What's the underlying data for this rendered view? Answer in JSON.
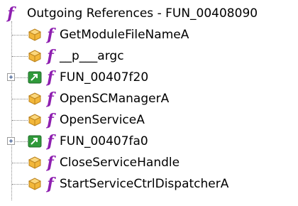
{
  "tree": {
    "root": {
      "label": "Outgoing References - FUN_00408090",
      "icon": "function-icon"
    },
    "items": [
      {
        "label": "GetModuleFileNameA",
        "icon": "external-function-icon",
        "expandable": false
      },
      {
        "label": "__p___argc",
        "icon": "external-function-icon",
        "expandable": false
      },
      {
        "label": "FUN_00407f20",
        "icon": "internal-call-icon",
        "expandable": true
      },
      {
        "label": "OpenSCManagerA",
        "icon": "external-function-icon",
        "expandable": false
      },
      {
        "label": "OpenServiceA",
        "icon": "external-function-icon",
        "expandable": false
      },
      {
        "label": "FUN_00407fa0",
        "icon": "internal-call-icon",
        "expandable": true
      },
      {
        "label": "CloseServiceHandle",
        "icon": "external-function-icon",
        "expandable": false
      },
      {
        "label": "StartServiceCtrlDispatcherA",
        "icon": "external-function-icon",
        "expandable": false
      }
    ]
  },
  "colors": {
    "function_glyph": "#8e1fb0",
    "external_icon": "#f2b73a",
    "internal_icon": "#2f9a3a"
  }
}
